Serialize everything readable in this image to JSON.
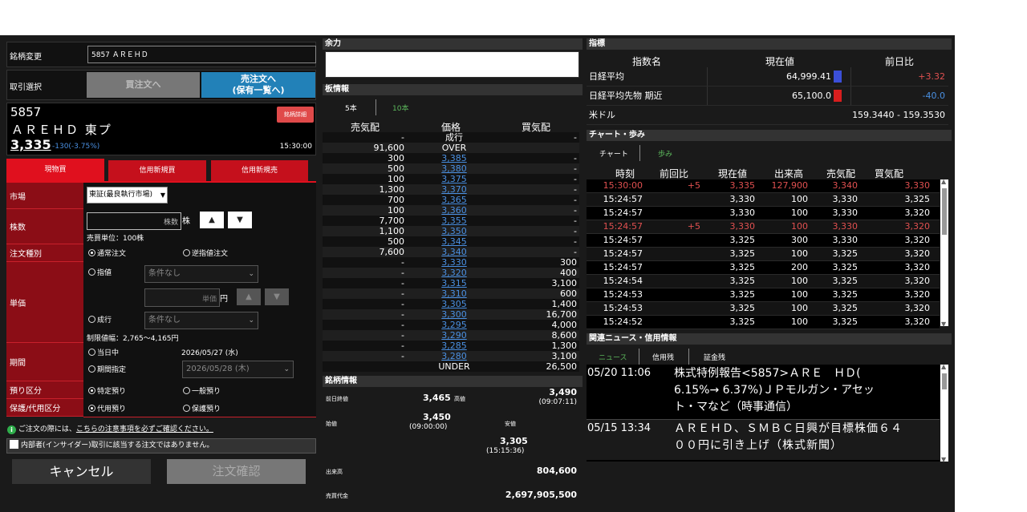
{
  "order": {
    "symbol_change_label": "銘柄変更",
    "symbol_input_value": "5857 ＡＲＥＨＤ",
    "trade_select_label": "取引選択",
    "buy_btn": "買注文へ",
    "sell_btn_line1": "売注文へ",
    "sell_btn_line2": "(保有一覧へ)",
    "code": "5857",
    "name": "ＡＲＥＨＤ 東プ",
    "price": "3,335",
    "change": "-130(-3.75%)",
    "time": "15:30:00",
    "detail_btn": "銘柄詳細",
    "tabs": [
      "現物買",
      "信用新規買",
      "信用新規売"
    ],
    "market_label": "市場",
    "market_value": "東証(最良執行市場)",
    "qty_label": "株数",
    "qty_placeholder": "株数",
    "qty_unit": "株",
    "qty_up": "▲",
    "qty_down": "▼",
    "trade_unit": "売買単位：100株",
    "order_type_label": "注文種別",
    "order_type_normal": "通常注文",
    "order_type_stop": "逆指値注文",
    "price_label": "単価",
    "limit_label": "指値",
    "cond_none_1": "条件なし",
    "price_placeholder": "単価",
    "price_unit": "円",
    "market_order_label": "成行",
    "cond_none_2": "条件なし",
    "price_limit": "制限値幅：2,765～4,165円",
    "period_label": "期間",
    "today_label": "当日中",
    "today_date": "2026/05/27 (水)",
    "period_spec_label": "期間指定",
    "period_date": "2026/05/28 (木)",
    "deposit_label": "預り区分",
    "deposit_specific": "特定預り",
    "deposit_general": "一般預り",
    "collateral_label": "保護/代用区分",
    "collateral_sub": "代用預り",
    "collateral_protect": "保護預り",
    "notice_prefix": "ご注文の際には、",
    "notice_link": "こちらの注意事項を必ずご確認ください。",
    "insider_text": "内部者(インサイダー)取引に該当する注文ではありません。",
    "cancel_btn": "キャンセル",
    "confirm_btn": "注文確認"
  },
  "board": {
    "yoryoku_title": "余力",
    "title": "板情報",
    "tab5": "5本",
    "tab10": "10本",
    "hdr_sell": "売気配",
    "hdr_price": "価格",
    "hdr_buy": "買気配",
    "rows": [
      {
        "sell": "-",
        "price": "成行",
        "buy": "-",
        "link": false
      },
      {
        "sell": "91,600",
        "price": "OVER",
        "buy": "",
        "link": false
      },
      {
        "sell": "300",
        "price": "3,385",
        "buy": "-",
        "link": true
      },
      {
        "sell": "500",
        "price": "3,380",
        "buy": "-",
        "link": true
      },
      {
        "sell": "100",
        "price": "3,375",
        "buy": "-",
        "link": true
      },
      {
        "sell": "1,300",
        "price": "3,370",
        "buy": "-",
        "link": true
      },
      {
        "sell": "700",
        "price": "3,365",
        "buy": "-",
        "link": true
      },
      {
        "sell": "100",
        "price": "3,360",
        "buy": "-",
        "link": true
      },
      {
        "sell": "7,700",
        "price": "3,355",
        "buy": "-",
        "link": true
      },
      {
        "sell": "1,100",
        "price": "3,350",
        "buy": "-",
        "link": true
      },
      {
        "sell": "500",
        "price": "3,345",
        "buy": "-",
        "link": true
      },
      {
        "sell": "7,600",
        "price": "3,340",
        "buy": "-",
        "link": true
      },
      {
        "sell": "-",
        "price": "3,330",
        "buy": "300",
        "link": true
      },
      {
        "sell": "-",
        "price": "3,320",
        "buy": "400",
        "link": true
      },
      {
        "sell": "-",
        "price": "3,315",
        "buy": "3,100",
        "link": true
      },
      {
        "sell": "-",
        "price": "3,310",
        "buy": "600",
        "link": true
      },
      {
        "sell": "-",
        "price": "3,305",
        "buy": "1,400",
        "link": true
      },
      {
        "sell": "-",
        "price": "3,300",
        "buy": "16,700",
        "link": true
      },
      {
        "sell": "-",
        "price": "3,295",
        "buy": "4,000",
        "link": true
      },
      {
        "sell": "-",
        "price": "3,290",
        "buy": "8,600",
        "link": true
      },
      {
        "sell": "-",
        "price": "3,285",
        "buy": "1,300",
        "link": true
      },
      {
        "sell": "-",
        "price": "3,280",
        "buy": "3,100",
        "link": true
      },
      {
        "sell": "",
        "price": "UNDER",
        "buy": "26,500",
        "link": false
      }
    ]
  },
  "stock_info": {
    "title": "銘柄情報",
    "prev_close_label": "前日終値",
    "prev_close": "3,465",
    "high_label": "高値",
    "high": "3,490",
    "high_time": "(09:07:11)",
    "open_label": "始値",
    "open": "3,450",
    "open_time": "(09:00:00)",
    "low_label": "安値",
    "low": "3,305",
    "low_time": "(15:15:36)",
    "volume_label": "出来高",
    "volume": "804,600",
    "turnover_label": "売買代金",
    "turnover": "2,697,905,500"
  },
  "index": {
    "title": "指標",
    "hdr_name": "指数名",
    "hdr_price": "現在値",
    "hdr_change": "前日比",
    "rows": [
      {
        "name": "日経平均",
        "price": "64,999.41",
        "change": "+3.32",
        "color": "#e05050",
        "bar": "#3b4fd8"
      },
      {
        "name": "日経平均先物 期近",
        "price": "65,100.0",
        "change": "-40.0",
        "color": "#4a90e2",
        "bar": "#d81e1e"
      },
      {
        "name": "米ドル",
        "price": "159.3440 - 159.3530",
        "change": "",
        "color": "#fff",
        "bar": ""
      }
    ]
  },
  "ticks": {
    "title": "チャート・歩み",
    "tab_chart": "チャート",
    "tab_ayumi": "歩み",
    "headers": [
      "時刻",
      "前回比",
      "現在値",
      "出来高",
      "売気配",
      "買気配"
    ],
    "rows": [
      {
        "t": "15:30:00",
        "d": "+5",
        "p": "3,335",
        "v": "127,900",
        "s": "3,340",
        "b": "3,330",
        "red": true
      },
      {
        "t": "15:24:57",
        "d": "",
        "p": "3,330",
        "v": "100",
        "s": "3,330",
        "b": "3,325",
        "red": false
      },
      {
        "t": "15:24:57",
        "d": "",
        "p": "3,330",
        "v": "100",
        "s": "3,330",
        "b": "3,320",
        "red": false
      },
      {
        "t": "15:24:57",
        "d": "+5",
        "p": "3,330",
        "v": "100",
        "s": "3,330",
        "b": "3,320",
        "red": true
      },
      {
        "t": "15:24:57",
        "d": "",
        "p": "3,325",
        "v": "300",
        "s": "3,330",
        "b": "3,320",
        "red": false
      },
      {
        "t": "15:24:57",
        "d": "",
        "p": "3,325",
        "v": "100",
        "s": "3,325",
        "b": "3,320",
        "red": false
      },
      {
        "t": "15:24:57",
        "d": "",
        "p": "3,325",
        "v": "200",
        "s": "3,325",
        "b": "3,320",
        "red": false
      },
      {
        "t": "15:24:54",
        "d": "",
        "p": "3,325",
        "v": "100",
        "s": "3,325",
        "b": "3,320",
        "red": false
      },
      {
        "t": "15:24:53",
        "d": "",
        "p": "3,325",
        "v": "100",
        "s": "3,325",
        "b": "3,320",
        "red": false
      },
      {
        "t": "15:24:53",
        "d": "",
        "p": "3,325",
        "v": "100",
        "s": "3,325",
        "b": "3,320",
        "red": false
      },
      {
        "t": "15:24:52",
        "d": "",
        "p": "3,325",
        "v": "100",
        "s": "3,325",
        "b": "3,320",
        "red": false
      }
    ]
  },
  "news": {
    "title": "関連ニュース・信用情報",
    "tabs": [
      "ニュース",
      "信用残",
      "証金残"
    ],
    "items": [
      {
        "date": "05/20 11:06",
        "line1": "株式特例報告<5857>ＡＲＥ　ＨＤ(",
        "line2": "6.15%→ 6.37%)ＪＰモルガン・アセッ",
        "line3": "ト・マなど（時事通信）"
      },
      {
        "date": "05/15 13:34",
        "line1": "ＡＲＥＨＤ、ＳＭＢＣ日興が目標株価６４",
        "line2": "００円に引き上げ（株式新聞）",
        "line3": ""
      }
    ]
  }
}
